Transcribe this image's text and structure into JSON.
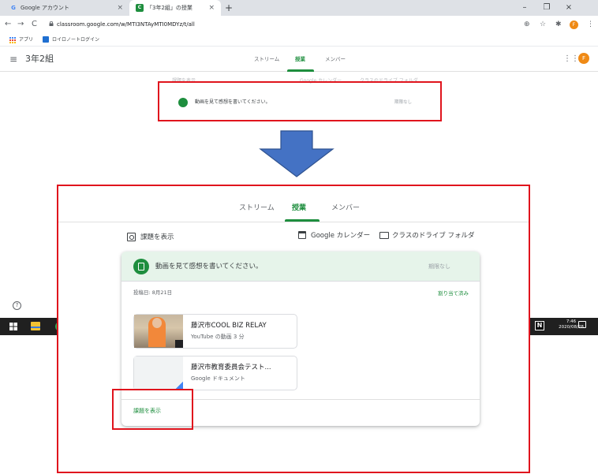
{
  "browser": {
    "tabs": [
      {
        "label": "Google アカウント",
        "favicon": "G"
      },
      {
        "label": "「3年2組」の授業",
        "favicon": "C"
      }
    ],
    "tab_close": "×",
    "new_tab": "+",
    "window_controls": {
      "minimize": "–",
      "maximize": "❐",
      "close": "×"
    },
    "url": "classroom.google.com/w/MTI3NTAyMTI0MDYz/t/all",
    "nav": {
      "back": "←",
      "forward": "→",
      "reload": "C"
    },
    "toolbar_icons": {
      "zoom": "⊕",
      "star": "☆",
      "extensions": "✱",
      "menu": "⋮",
      "profile_initial": "F"
    },
    "bookmarks": [
      {
        "label": "アプリ"
      },
      {
        "label": "ロイロノートログイン"
      }
    ]
  },
  "classroom_top": {
    "menu_icon": "≡",
    "class_name": "3年2組",
    "tabs": [
      "ストリーム",
      "授業",
      "メンバー"
    ],
    "active_tab": "授業",
    "apps_icon": "⋮⋮⋮",
    "avatar_initial": "F",
    "faint_links": [
      "課題を表示",
      "Google カレンダー",
      "クラスのドライブ フォルダ"
    ],
    "assignment_title": "動画を見て感想を書いてください。",
    "assignment_due": "期限なし"
  },
  "taskbar": {
    "time": "7:46",
    "date": "2020/08/28",
    "help_icon": "?",
    "app_letter": "N"
  },
  "zoom": {
    "tabs": [
      "ストリーム",
      "授業",
      "メンバー"
    ],
    "active_tab": "授業",
    "view_link": "課題を表示",
    "calendar_link": "Google カレンダー",
    "drive_link": "クラスのドライブ フォルダ",
    "card": {
      "title": "動画を見て感想を書いてください。",
      "due": "期限なし",
      "posted": "投稿日: 8月21日",
      "status": "割り当て済み",
      "attachments": [
        {
          "title": "藤沢市COOL BIZ RELAY",
          "subtitle": "YouTube の動画 3 分"
        },
        {
          "title": "藤沢市教育委員会テスト...",
          "subtitle": "Google ドキュメント"
        }
      ],
      "footer_link": "課題を表示"
    }
  },
  "colors": {
    "accent_green": "#1e8e3e",
    "highlight_red": "#e0141d",
    "arrow_blue": "#4472c4",
    "profile_orange": "#ef8a15"
  }
}
